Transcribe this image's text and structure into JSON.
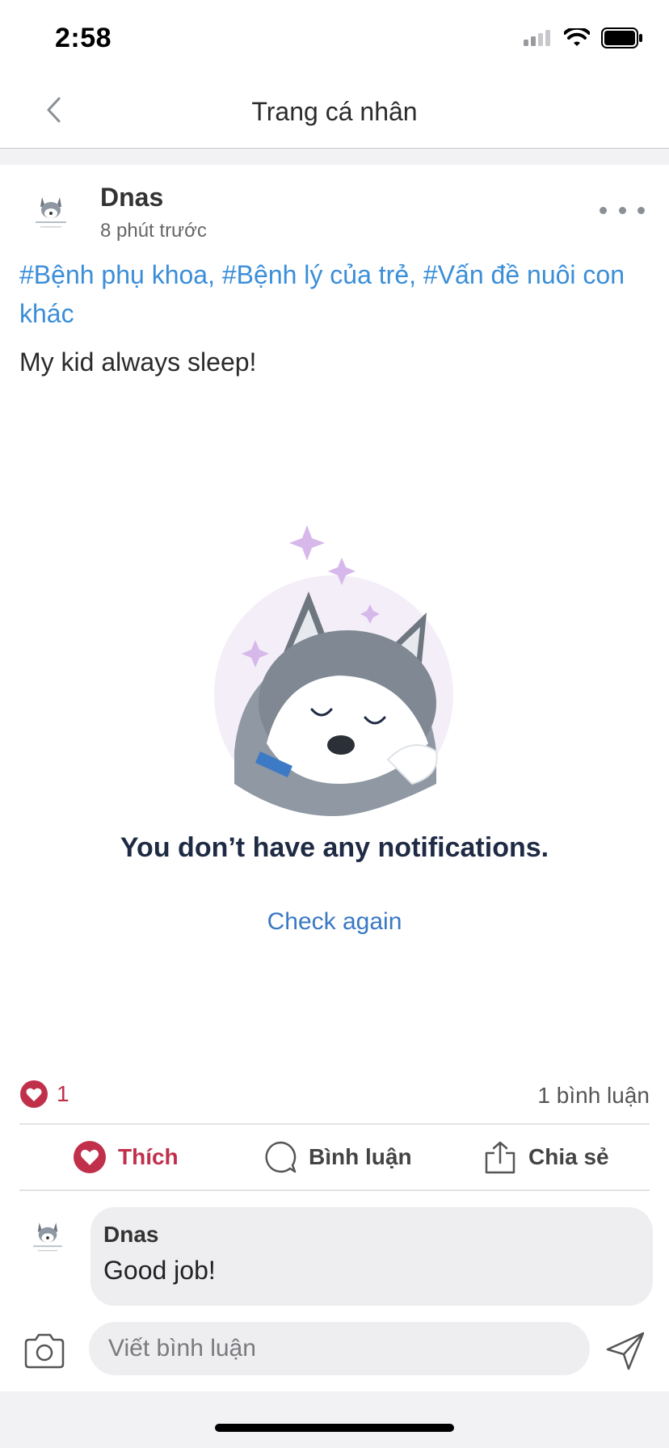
{
  "status_bar": {
    "time": "2:58",
    "icons": [
      "cellular-signal-icon",
      "wifi-icon",
      "battery-icon"
    ]
  },
  "nav": {
    "back_icon": "chevron-left-icon",
    "title": "Trang cá nhân"
  },
  "post": {
    "author": "Dnas",
    "time": "8 phút trước",
    "more_icon": "more-horizontal-icon",
    "tags": "#Bệnh phụ khoa, #Bệnh lý của trẻ, #Vấn đề nuôi con khác",
    "text": "My kid always sleep!",
    "image": {
      "caption": "You don’t have any notifications.",
      "link": "Check again"
    },
    "like_count": "1",
    "comment_count": "1 bình luận"
  },
  "actions": {
    "like": "Thích",
    "comment": "Bình luận",
    "share": "Chia sẻ"
  },
  "comment": {
    "author": "Dnas",
    "text": "Good job!"
  },
  "compose": {
    "placeholder": "Viết bình luận",
    "camera_icon": "camera-icon",
    "send_icon": "send-icon"
  },
  "colors": {
    "accent_red": "#c0304b",
    "tag_blue": "#3a8ed8",
    "link_blue": "#3a78c4"
  }
}
